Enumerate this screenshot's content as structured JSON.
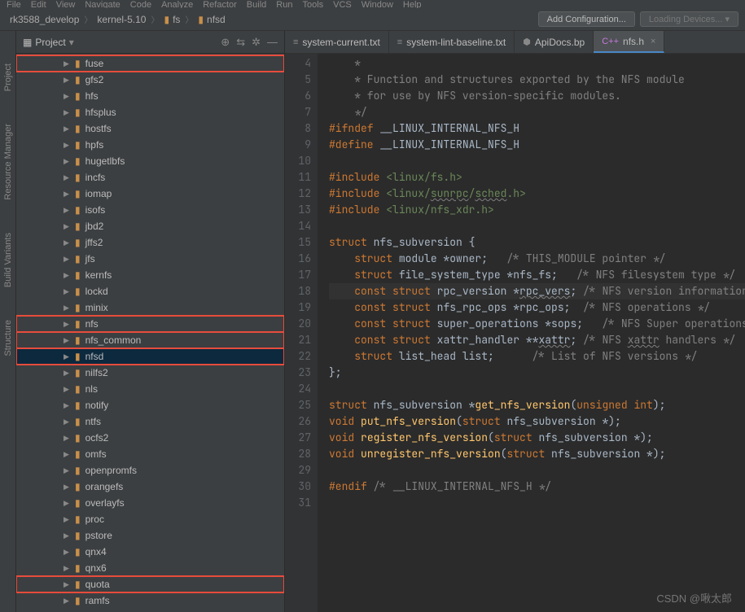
{
  "menubar": [
    "File",
    "Edit",
    "View",
    "Navigate",
    "Code",
    "Analyze",
    "Refactor",
    "Build",
    "Run",
    "Tools",
    "VCS",
    "Window",
    "Help"
  ],
  "breadcrumb": [
    "rk3588_develop",
    "kernel-5.10",
    "fs",
    "nfsd"
  ],
  "nav": {
    "addConfig": "Add Configuration...",
    "loadingDevices": "Loading Devices..."
  },
  "panel": {
    "title": "Project"
  },
  "rails": [
    "Project",
    "Resource Manager",
    "Build Variants",
    "Structure"
  ],
  "tree": [
    {
      "label": "fuse",
      "hl": true
    },
    {
      "label": "gfs2"
    },
    {
      "label": "hfs"
    },
    {
      "label": "hfsplus"
    },
    {
      "label": "hostfs"
    },
    {
      "label": "hpfs"
    },
    {
      "label": "hugetlbfs"
    },
    {
      "label": "incfs"
    },
    {
      "label": "iomap"
    },
    {
      "label": "isofs"
    },
    {
      "label": "jbd2"
    },
    {
      "label": "jffs2"
    },
    {
      "label": "jfs"
    },
    {
      "label": "kernfs"
    },
    {
      "label": "lockd"
    },
    {
      "label": "minix"
    },
    {
      "label": "nfs",
      "hl": true
    },
    {
      "label": "nfs_common",
      "hl": true
    },
    {
      "label": "nfsd",
      "hl": true,
      "sel": true
    },
    {
      "label": "nilfs2"
    },
    {
      "label": "nls"
    },
    {
      "label": "notify"
    },
    {
      "label": "ntfs"
    },
    {
      "label": "ocfs2"
    },
    {
      "label": "omfs"
    },
    {
      "label": "openpromfs"
    },
    {
      "label": "orangefs"
    },
    {
      "label": "overlayfs"
    },
    {
      "label": "proc"
    },
    {
      "label": "pstore"
    },
    {
      "label": "qnx4"
    },
    {
      "label": "qnx6"
    },
    {
      "label": "quota",
      "hl": true
    },
    {
      "label": "ramfs"
    }
  ],
  "tabs": [
    {
      "icon": "≡",
      "label": "system-current.txt",
      "active": false
    },
    {
      "icon": "≡",
      "label": "system-lint-baseline.txt",
      "active": false
    },
    {
      "icon": "⬢",
      "label": "ApiDocs.bp",
      "active": false
    },
    {
      "icon": "C++",
      "label": "nfs.h",
      "active": true
    }
  ],
  "code": {
    "startLine": 4,
    "lines": [
      {
        "n": 4,
        "html": "    <span class='k-cm'>*</span>"
      },
      {
        "n": 5,
        "html": "    <span class='k-cm'>* Function and structures exported by the NFS module</span>"
      },
      {
        "n": 6,
        "html": "    <span class='k-cm'>* for use by NFS version-specific modules.</span>"
      },
      {
        "n": 7,
        "html": "    <span class='k-cm'>*/</span>"
      },
      {
        "n": 8,
        "html": "<span class='k-kw'>#ifndef</span> <span class='k-id'>__LINUX_INTERNAL_NFS_H</span>"
      },
      {
        "n": 9,
        "html": "<span class='k-kw'>#define</span> <span class='k-id'>__LINUX_INTERNAL_NFS_H</span>"
      },
      {
        "n": 10,
        "html": ""
      },
      {
        "n": 11,
        "html": "<span class='k-kw'>#include</span> <span class='k-inc'>&lt;linux/fs.h&gt;</span>"
      },
      {
        "n": 12,
        "html": "<span class='k-kw'>#include</span> <span class='k-inc'>&lt;linux/<span class='underline-wavy'>sunrpc</span>/<span class='underline-wavy'>sched</span>.h&gt;</span>"
      },
      {
        "n": 13,
        "html": "<span class='k-kw'>#include</span> <span class='k-inc'>&lt;linux/nfs_xdr.h&gt;</span>"
      },
      {
        "n": 14,
        "html": ""
      },
      {
        "n": 15,
        "html": "<span class='k-kw'>struct</span> <span class='k-ty'>nfs_subversion</span> {"
      },
      {
        "n": 16,
        "html": "    <span class='k-kw'>struct</span> module *owner;   <span class='k-cm'>/* THIS_MODULE pointer */</span>"
      },
      {
        "n": 17,
        "html": "    <span class='k-kw'>struct</span> file_system_type *nfs_fs;   <span class='k-cm'>/* NFS filesystem type */</span>"
      },
      {
        "n": 18,
        "hl": true,
        "html": "    <span class='k-kw'>const</span> <span class='k-kw'>struct</span> rpc_version *<span class='underline-wavy'>rpc_vers</span>; <span class='k-cm'>/* NFS version information */</span>"
      },
      {
        "n": 19,
        "html": "    <span class='k-kw'>const</span> <span class='k-kw'>struct</span> nfs_rpc_ops *rpc_ops;  <span class='k-cm'>/* NFS operations */</span>"
      },
      {
        "n": 20,
        "html": "    <span class='k-kw'>const</span> <span class='k-kw'>struct</span> super_operations *sops;   <span class='k-cm'>/* NFS Super operations */</span>"
      },
      {
        "n": 21,
        "html": "    <span class='k-kw'>const</span> <span class='k-kw'>struct</span> xattr_handler **<span class='underline-wavy'>xattr</span>; <span class='k-cm'>/* NFS <span class='underline-wavy'>xattr</span> handlers */</span>"
      },
      {
        "n": 22,
        "html": "    <span class='k-kw'>struct</span> list_head list;      <span class='k-cm'>/* List of NFS versions */</span>"
      },
      {
        "n": 23,
        "html": "};"
      },
      {
        "n": 24,
        "html": ""
      },
      {
        "n": 25,
        "html": "<span class='k-kw'>struct</span> nfs_subversion *<span class='k-fn'>get_nfs_version</span>(<span class='k-kw'>unsigned int</span>);"
      },
      {
        "n": 26,
        "html": "<span class='k-kw'>void</span> <span class='k-fn'>put_nfs_version</span>(<span class='k-kw'>struct</span> nfs_subversion *);"
      },
      {
        "n": 27,
        "html": "<span class='k-kw'>void</span> <span class='k-fn'>register_nfs_version</span>(<span class='k-kw'>struct</span> nfs_subversion *);"
      },
      {
        "n": 28,
        "html": "<span class='k-kw'>void</span> <span class='k-fn'>unregister_nfs_version</span>(<span class='k-kw'>struct</span> nfs_subversion *);"
      },
      {
        "n": 29,
        "html": ""
      },
      {
        "n": 30,
        "html": "<span class='k-kw'>#endif</span> <span class='k-cm'>/* __LINUX_INTERNAL_NFS_H */</span>"
      },
      {
        "n": 31,
        "html": ""
      }
    ]
  },
  "watermark": "CSDN @啾太郎"
}
